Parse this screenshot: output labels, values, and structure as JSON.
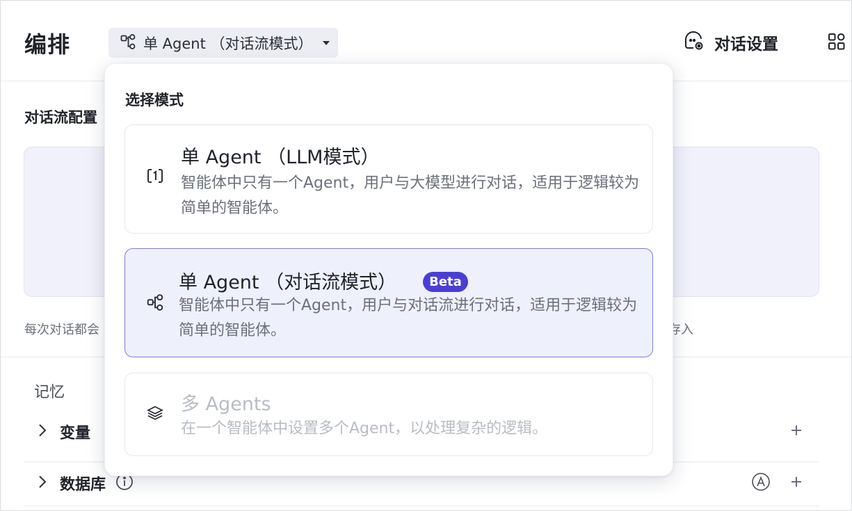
{
  "header": {
    "title": "编排",
    "mode_selector": {
      "label": "单 Agent （对话流模式）",
      "icon": "flow-nodes-icon"
    },
    "chat_settings": {
      "label": "对话设置",
      "icon": "chat-settings-icon"
    },
    "layout_icon": "layout-grid-icon"
  },
  "main": {
    "section_title": "对话流配置",
    "hint_text_left": "每次对话都会",
    "hint_text_right": "存入"
  },
  "memory": {
    "title": "记忆",
    "rows": [
      {
        "label": "变量"
      },
      {
        "label": "数据库"
      }
    ]
  },
  "dropdown": {
    "title": "选择模式",
    "options": [
      {
        "title": "单 Agent （LLM模式）",
        "description": "智能体中只有一个Agent，用户与大模型进行对话，适用于逻辑较为简单的智能体。",
        "icon": "single-agent-icon",
        "selected": false,
        "disabled": false
      },
      {
        "title": "单 Agent （对话流模式）",
        "badge": "Beta",
        "description": "智能体中只有一个Agent，用户与对话流进行对话，适用于逻辑较为简单的智能体。",
        "icon": "flow-nodes-icon",
        "selected": true,
        "disabled": false
      },
      {
        "title": "多 Agents",
        "description": "在一个智能体中设置多个Agent，以处理复杂的逻辑。",
        "icon": "layers-icon",
        "selected": false,
        "disabled": true
      }
    ]
  },
  "colors": {
    "accent": "#4a3fd4",
    "selected_bg": "#eef0fc",
    "selected_border": "#7b7fd4",
    "disabled_text": "#b8bcc3"
  }
}
